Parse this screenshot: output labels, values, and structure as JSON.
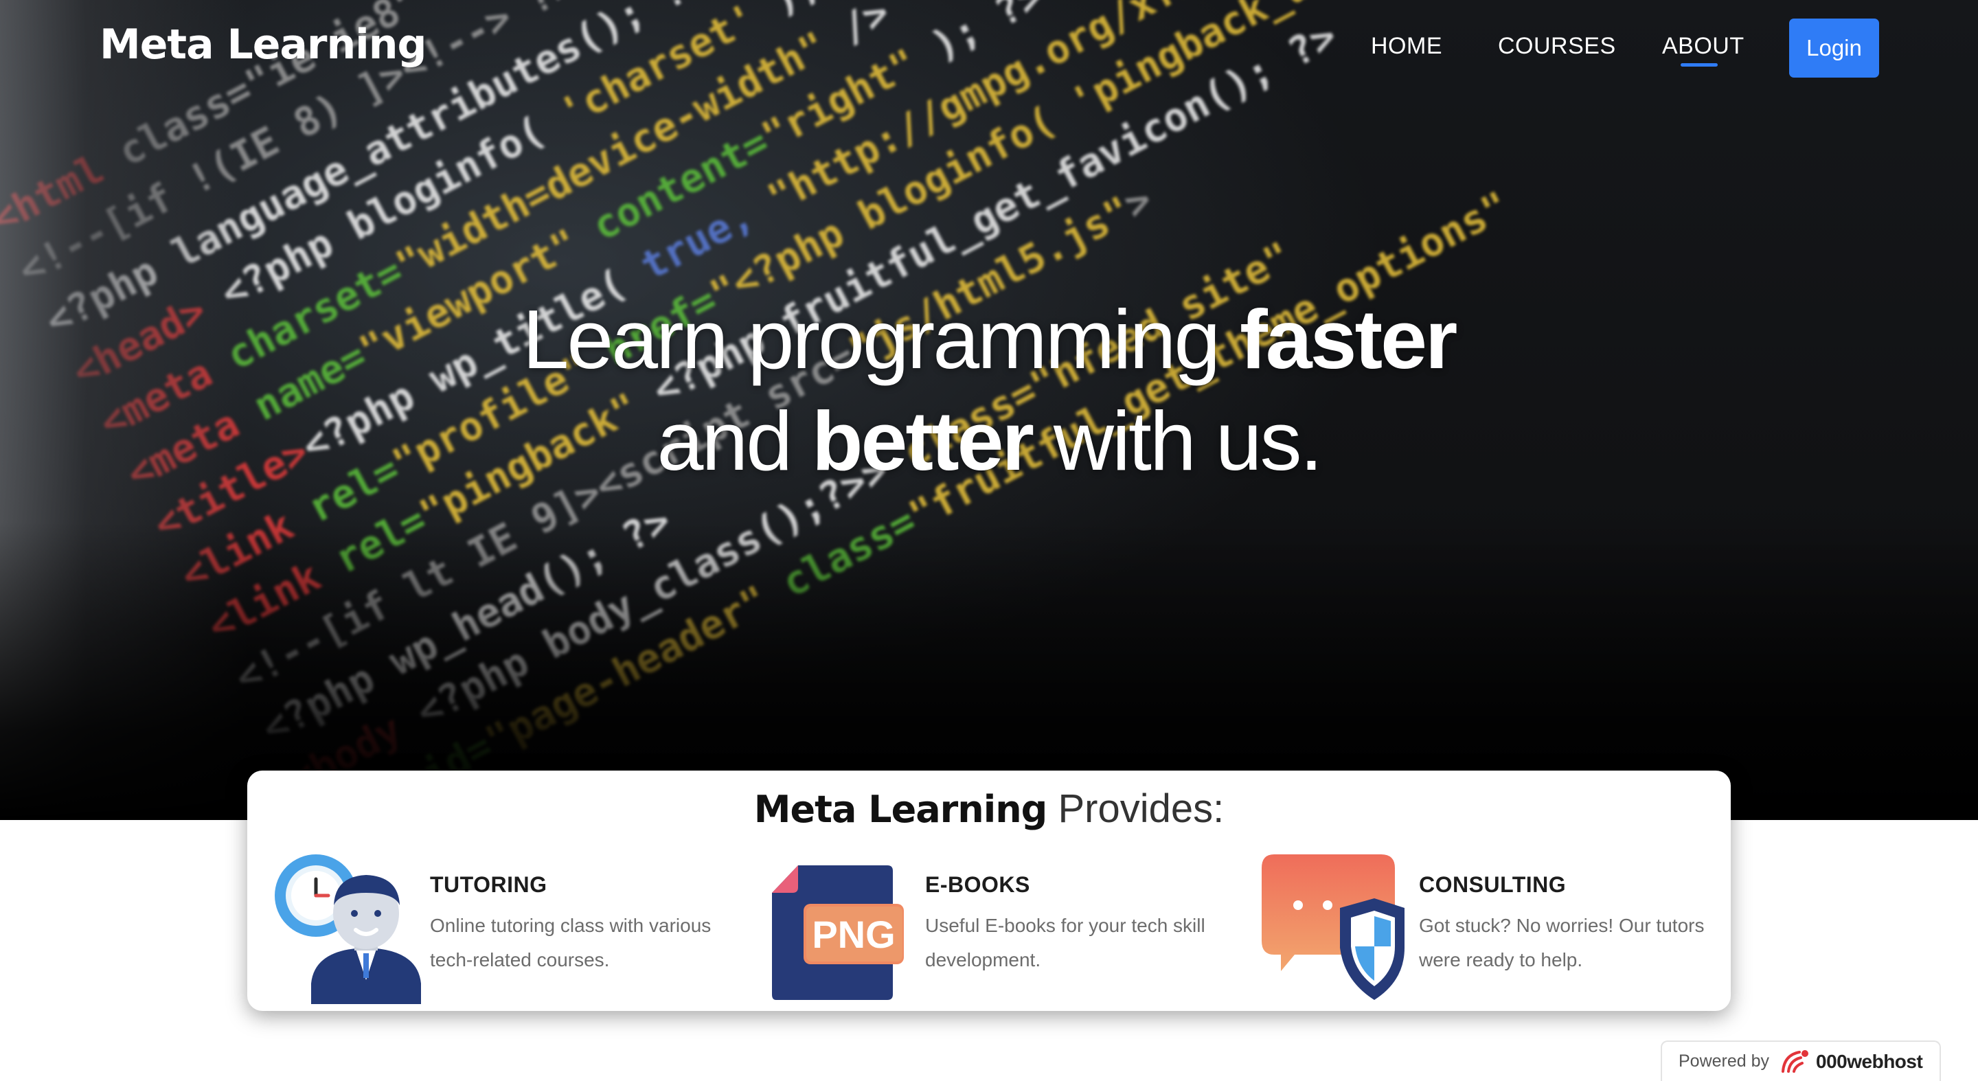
{
  "nav": {
    "brand": "Meta Learning",
    "links": [
      {
        "label": "HOME"
      },
      {
        "label": "COURSES"
      },
      {
        "label": "ABOUT",
        "active": true
      }
    ],
    "login_label": "Login"
  },
  "hero": {
    "line1_light": "Learn programming ",
    "line1_bold": "faster",
    "line2_light_a": "and ",
    "line2_bold": "better",
    "line2_light_b": " with us."
  },
  "provides": {
    "title_bold": "Meta Learning",
    "title_light": " Provides:",
    "features": [
      {
        "icon": "tutor-clock-icon",
        "title": "TUTORING",
        "description": "Online tutoring class with various tech-related courses."
      },
      {
        "icon": "png-ebook-icon",
        "title": "E-BOOKS",
        "description": "Useful E-books for your tech skill development."
      },
      {
        "icon": "chat-shield-icon",
        "title": "CONSULTING",
        "description": "Got stuck? No worries! Our tutors were ready to help."
      }
    ],
    "ebook_icon_text": "PNG"
  },
  "badge": {
    "label": "Powered by",
    "brand": "000webhost"
  },
  "colors": {
    "accent": "#2f7cf6",
    "hero_bg": "#111214",
    "card_bg": "#ffffff"
  }
}
